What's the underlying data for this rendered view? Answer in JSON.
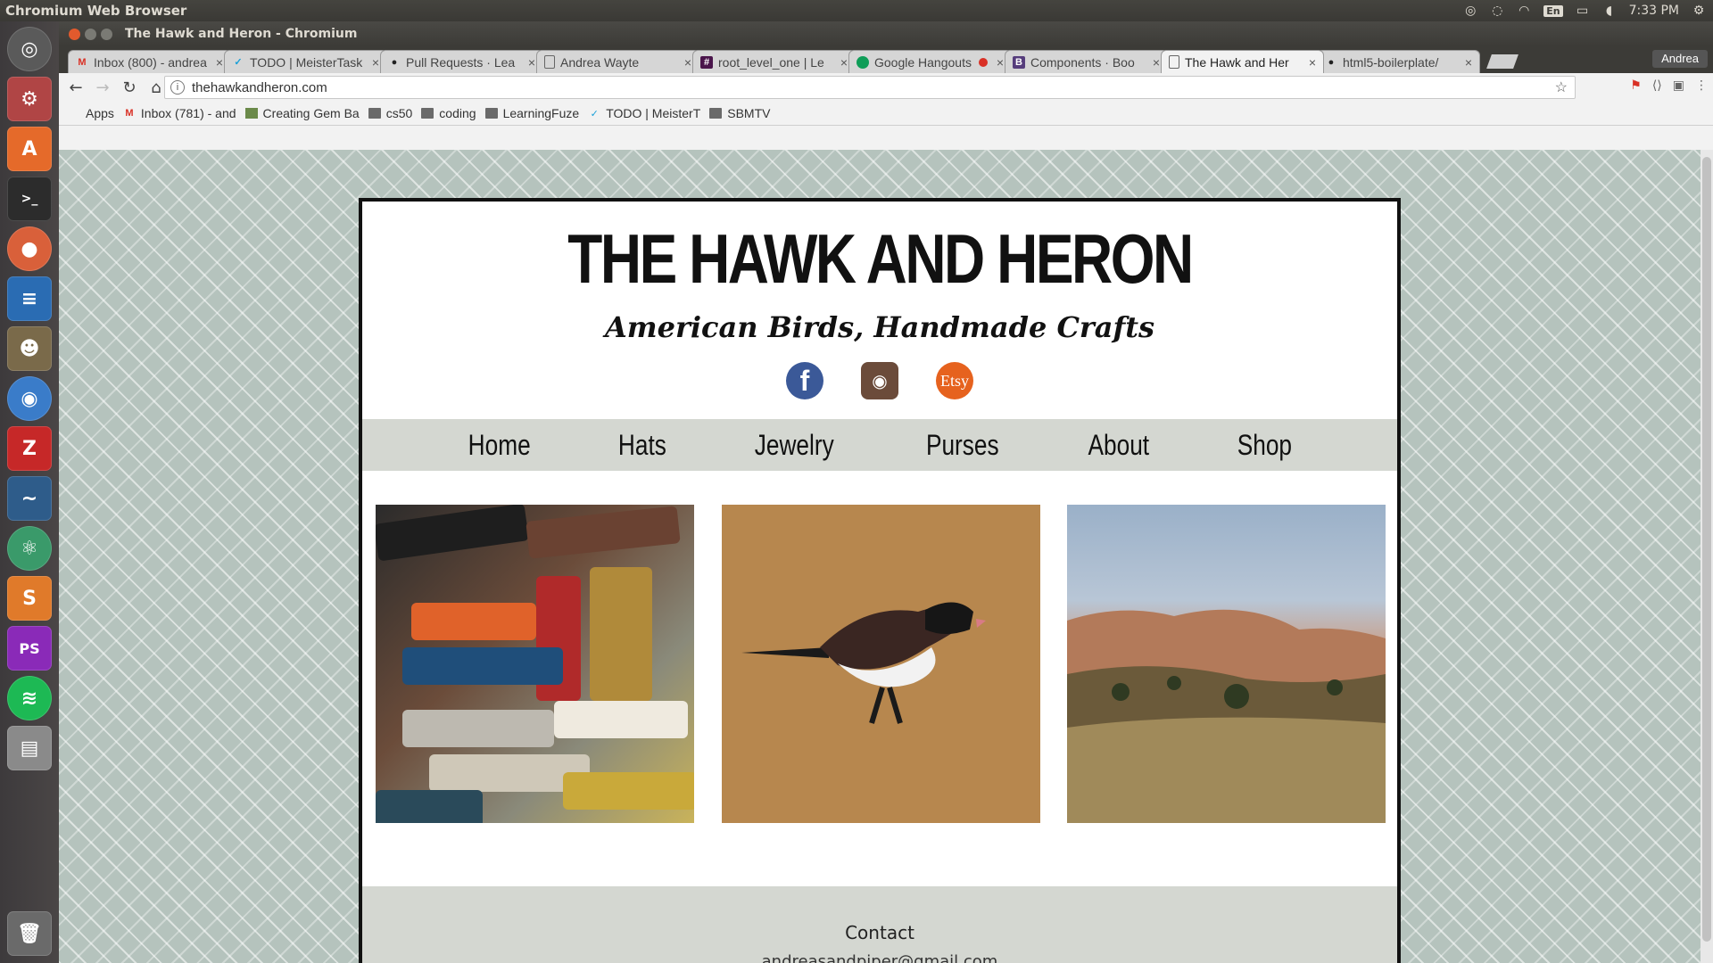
{
  "top_panel": {
    "app_name": "Chromium Web Browser",
    "lang": "En",
    "clock": "7:33 PM"
  },
  "window": {
    "title": "The Hawk and Heron - Chromium"
  },
  "tabs": [
    {
      "label": "Inbox (800) - andrea",
      "icon": "gmail-icon"
    },
    {
      "label": "TODO | MeisterTask",
      "icon": "check-icon"
    },
    {
      "label": "Pull Requests · Lea",
      "icon": "github-icon"
    },
    {
      "label": "Andrea Wayte",
      "icon": "page-icon"
    },
    {
      "label": "root_level_one | Le",
      "icon": "slack-icon"
    },
    {
      "label": "Google Hangouts",
      "icon": "hangouts-icon"
    },
    {
      "label": "Components · Boo",
      "icon": "bootstrap-icon"
    },
    {
      "label": "The Hawk and Her",
      "icon": "page-icon"
    },
    {
      "label": "html5-boilerplate/",
      "icon": "github-icon"
    }
  ],
  "profile": "Andrea",
  "omnibox": {
    "url": "thehawkandheron.com"
  },
  "bookmarks": [
    {
      "label": "Apps",
      "icon": "apps-icon"
    },
    {
      "label": "Inbox (781) - and",
      "icon": "gmail-icon"
    },
    {
      "label": "Creating Gem Ba",
      "icon": "page-icon"
    },
    {
      "label": "cs50",
      "icon": "folder-icon"
    },
    {
      "label": "coding",
      "icon": "folder-icon"
    },
    {
      "label": "LearningFuze",
      "icon": "folder-icon"
    },
    {
      "label": "TODO | MeisterT",
      "icon": "check-icon"
    },
    {
      "label": "SBMTV",
      "icon": "folder-icon"
    }
  ],
  "site": {
    "title": "THE HAWK AND HERON",
    "tagline": "American Birds, Handmade Crafts",
    "social": {
      "etsy": "Etsy"
    },
    "nav": [
      "Home",
      "Hats",
      "Jewelry",
      "Purses",
      "About",
      "Shop"
    ],
    "footer": {
      "heading": "Contact",
      "email": "andreasandpiper@gmail.com"
    }
  },
  "colors": {
    "nav_bg": "#d4d7d1",
    "facebook": "#3b5998",
    "etsy": "#e6621e"
  }
}
